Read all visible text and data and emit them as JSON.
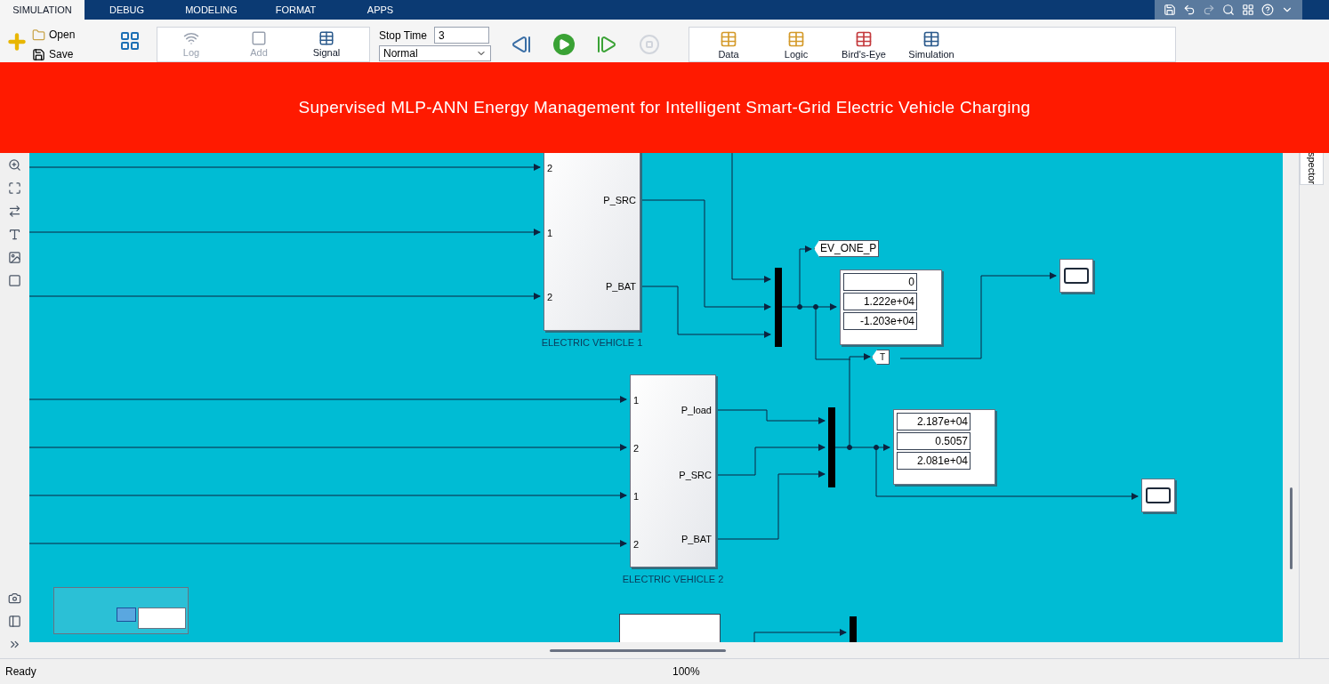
{
  "tabs": [
    {
      "label": "SIMULATION",
      "selected": true
    },
    {
      "label": "DEBUG",
      "selected": false
    },
    {
      "label": "MODELING",
      "selected": false
    },
    {
      "label": "FORMAT",
      "selected": false
    },
    {
      "label": "APPS",
      "selected": false
    }
  ],
  "toolbar": {
    "open": "Open",
    "save": "Save",
    "log": "Log",
    "add": "Add",
    "signal": "Signal",
    "stop_time_label": "Stop Time",
    "stop_time": "3",
    "mode": "Normal",
    "review": [
      "Data",
      "Logic",
      "Bird's-Eye",
      "Simulation"
    ]
  },
  "banner": "Supervised MLP-ANN Energy Management for Intelligent Smart-Grid Electric Vehicle Charging",
  "subsystems": [
    {
      "name": "ELECTRIC VEHICLE 1",
      "inports": [
        "2",
        "1",
        "2"
      ],
      "outports": [
        "P_SRC",
        "P_BAT"
      ]
    },
    {
      "name": "ELECTRIC VEHICLE 2",
      "inports": [
        "1",
        "2",
        "1",
        "2"
      ],
      "outports": [
        "P_load",
        "P_SRC",
        "P_BAT"
      ]
    }
  ],
  "displays": [
    {
      "values": [
        "0",
        "1.222e+04",
        "-1.203e+04"
      ]
    },
    {
      "values": [
        "2.187e+04",
        "0.5057",
        "2.081e+04"
      ]
    }
  ],
  "goto_tag": "EV_ONE_P",
  "from_tag": "T",
  "side_tab": "spector",
  "status": {
    "text": "Ready",
    "zoom": "100%"
  }
}
